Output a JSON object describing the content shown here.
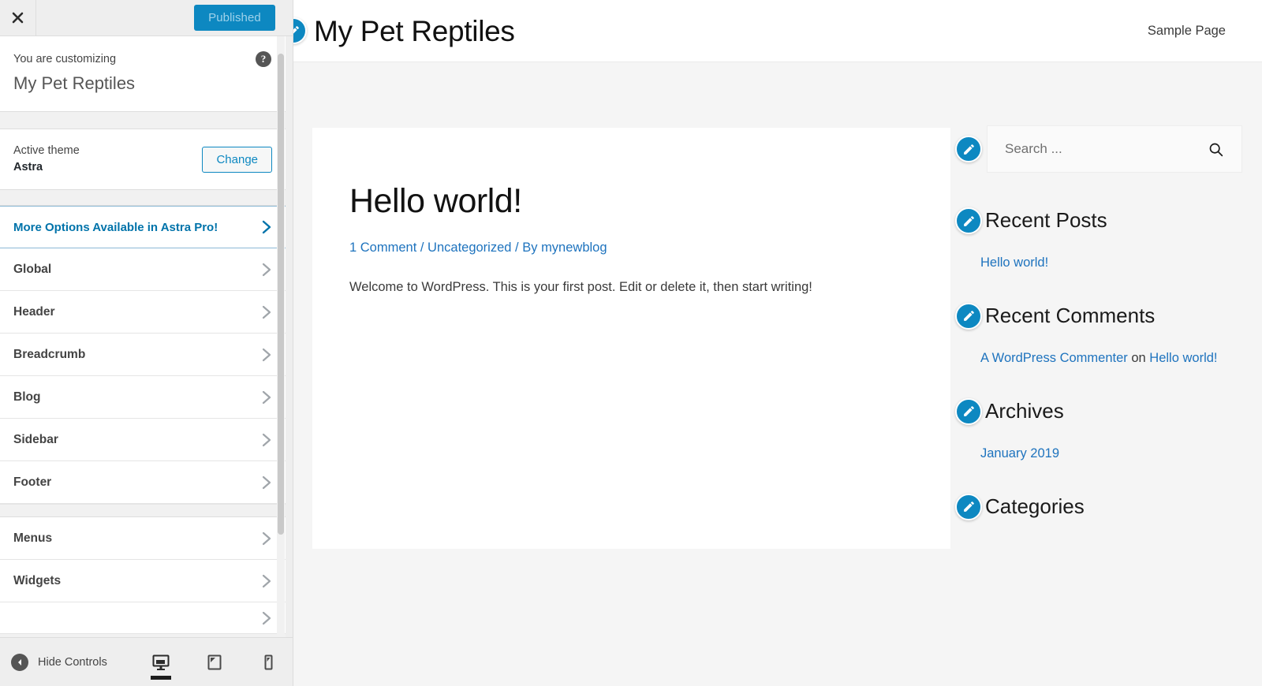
{
  "customizer": {
    "close_label": "Close",
    "publish_label": "Published",
    "info": {
      "eyebrow": "You are customizing",
      "site_title": "My Pet Reptiles",
      "help_label": "?"
    },
    "theme": {
      "label": "Active theme",
      "name": "Astra",
      "change_label": "Change"
    },
    "pro_notice": {
      "label": "More Options Available in Astra Pro!"
    },
    "sections_group_1": [
      {
        "label": "Global"
      },
      {
        "label": "Header"
      },
      {
        "label": "Breadcrumb"
      },
      {
        "label": "Blog"
      },
      {
        "label": "Sidebar"
      },
      {
        "label": "Footer"
      }
    ],
    "sections_group_2": [
      {
        "label": "Menus"
      },
      {
        "label": "Widgets"
      }
    ],
    "footer": {
      "hide_controls_label": "Hide Controls",
      "devices": [
        {
          "name": "desktop",
          "active": true
        },
        {
          "name": "tablet",
          "active": false
        },
        {
          "name": "mobile",
          "active": false
        }
      ]
    }
  },
  "preview": {
    "site_title": "My Pet Reptiles",
    "nav": [
      {
        "label": "Sample Page"
      }
    ],
    "post": {
      "title": "Hello world!",
      "meta_comment": "1 Comment",
      "meta_sep1": " / ",
      "meta_category": "Uncategorized",
      "meta_sep2": " / ",
      "meta_author_prefix": "By ",
      "meta_author": "mynewblog",
      "excerpt": "Welcome to WordPress. This is your first post. Edit or delete it, then start writing!"
    },
    "widgets": {
      "search": {
        "placeholder": "Search ..."
      },
      "recent_posts": {
        "title": "Recent Posts",
        "items": [
          {
            "label": "Hello world!"
          }
        ]
      },
      "recent_comments": {
        "title": "Recent Comments",
        "comment_author": "A WordPress Commenter",
        "comment_on": " on ",
        "comment_post": "Hello world!"
      },
      "archives": {
        "title": "Archives",
        "items": [
          {
            "label": "January 2019"
          }
        ]
      },
      "categories": {
        "title": "Categories"
      }
    }
  },
  "colors": {
    "accent": "#0d88c1",
    "link": "#1e73be",
    "pro_link": "#0073aa",
    "sidebar_bg": "#eeeeee"
  }
}
